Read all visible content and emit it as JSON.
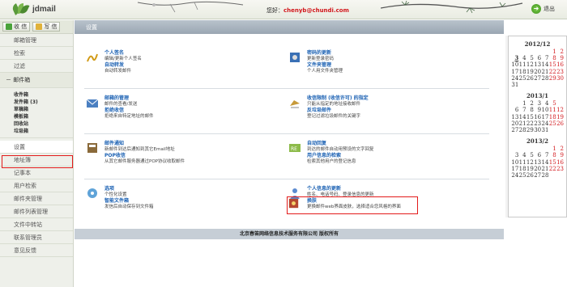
{
  "header": {
    "logo_text": "jdmail",
    "welcome_prefix": "您好：",
    "email": "chenyb@chundi.com",
    "logout_label": "退出"
  },
  "sidebar": {
    "receive_label": "收 信",
    "compose_label": "写 信",
    "items_top": [
      "邮箱管理",
      "检索",
      "过滤"
    ],
    "mailbox_group": "－ 邮件箱",
    "folders": [
      "收件箱",
      "发件箱 (3)",
      "草稿箱",
      "模板箱",
      "回收站",
      "垃圾箱"
    ],
    "items_bottom": [
      "设置",
      "地址簿",
      "记事本",
      "用户检索",
      "邮件夹管理",
      "邮件列表管理",
      "文件中转站",
      "联系管理员",
      "意见反馈"
    ]
  },
  "main": {
    "bar_title": "设置",
    "cards": [
      {
        "title": "个人签名",
        "desc": "编辑/更新个人签名",
        "title2": "自动转发",
        "desc2": "自动转发邮件"
      },
      {
        "title": "密码的更新",
        "desc": "更新登录密码",
        "title2": "文件夹管理",
        "desc2": "个人用文件夹管理"
      },
      {
        "title": "邮箱的管理",
        "desc": "邮件的查看/发送",
        "title2": "拒绝收信",
        "desc2": "拒绝来自特定地址的邮件"
      },
      {
        "title": "收信限制 (收信许可) 的指定",
        "desc": "只能从指定的地址接收邮件",
        "title2": "反垃圾邮件",
        "desc2": "登记过滤垃圾邮件的关键字"
      },
      {
        "title": "邮件通知",
        "desc": "新邮件到达后通知到其它Email地址",
        "title2": "POP收信",
        "desc2": "从其它邮件服务器通过POP协议收取邮件"
      },
      {
        "title": "自动回复",
        "desc": "到达的邮件自动用预设的文字回复",
        "title2": "用户信息的检索",
        "desc2": "检索其他用户的登记信息"
      },
      {
        "title": "选项",
        "desc": "个性化设置",
        "title2": "智能文件箱",
        "desc2": "发信后自动保存到文件箱"
      },
      {
        "title": "个人信息的更新",
        "desc": "姓名、电话号码、登录信息的更新",
        "title2": "换肤",
        "desc2": "更换邮件web界面皮肤，选择适合您风格的界面"
      }
    ],
    "footer": "北京春笛网络信息技术服务有限公司  版权所有"
  },
  "calendar": [
    {
      "title": "2012/12",
      "rows": [
        [
          "",
          "",
          "",
          "",
          "",
          "1",
          "2"
        ],
        [
          "3",
          "4",
          "5",
          "6",
          "7",
          "8",
          "9"
        ],
        [
          "10",
          "11",
          "12",
          "13",
          "14",
          "15",
          "16"
        ],
        [
          "17",
          "18",
          "19",
          "20",
          "21",
          "22",
          "23"
        ],
        [
          "24",
          "25",
          "26",
          "27",
          "28",
          "29",
          "30"
        ],
        [
          "31",
          "",
          "",
          "",
          "",
          "",
          ""
        ]
      ]
    },
    {
      "title": "2013/1",
      "rows": [
        [
          "",
          "1",
          "2",
          "3",
          "4",
          "5",
          ""
        ],
        [
          "6",
          "7",
          "8",
          "9",
          "10",
          "11",
          "12"
        ],
        [
          "13",
          "14",
          "15",
          "16",
          "17",
          "18",
          "19"
        ],
        [
          "20",
          "21",
          "22",
          "23",
          "24",
          "25",
          "26"
        ],
        [
          "27",
          "28",
          "29",
          "30",
          "31",
          "",
          ""
        ]
      ]
    },
    {
      "title": "2013/2",
      "rows": [
        [
          "",
          "",
          "",
          "",
          "",
          "1",
          "2"
        ],
        [
          "3",
          "4",
          "5",
          "6",
          "7",
          "8",
          "9"
        ],
        [
          "10",
          "11",
          "12",
          "13",
          "14",
          "15",
          "16"
        ],
        [
          "17",
          "18",
          "19",
          "20",
          "21",
          "22",
          "23"
        ],
        [
          "24",
          "25",
          "26",
          "27",
          "28",
          "",
          ""
        ]
      ]
    }
  ]
}
